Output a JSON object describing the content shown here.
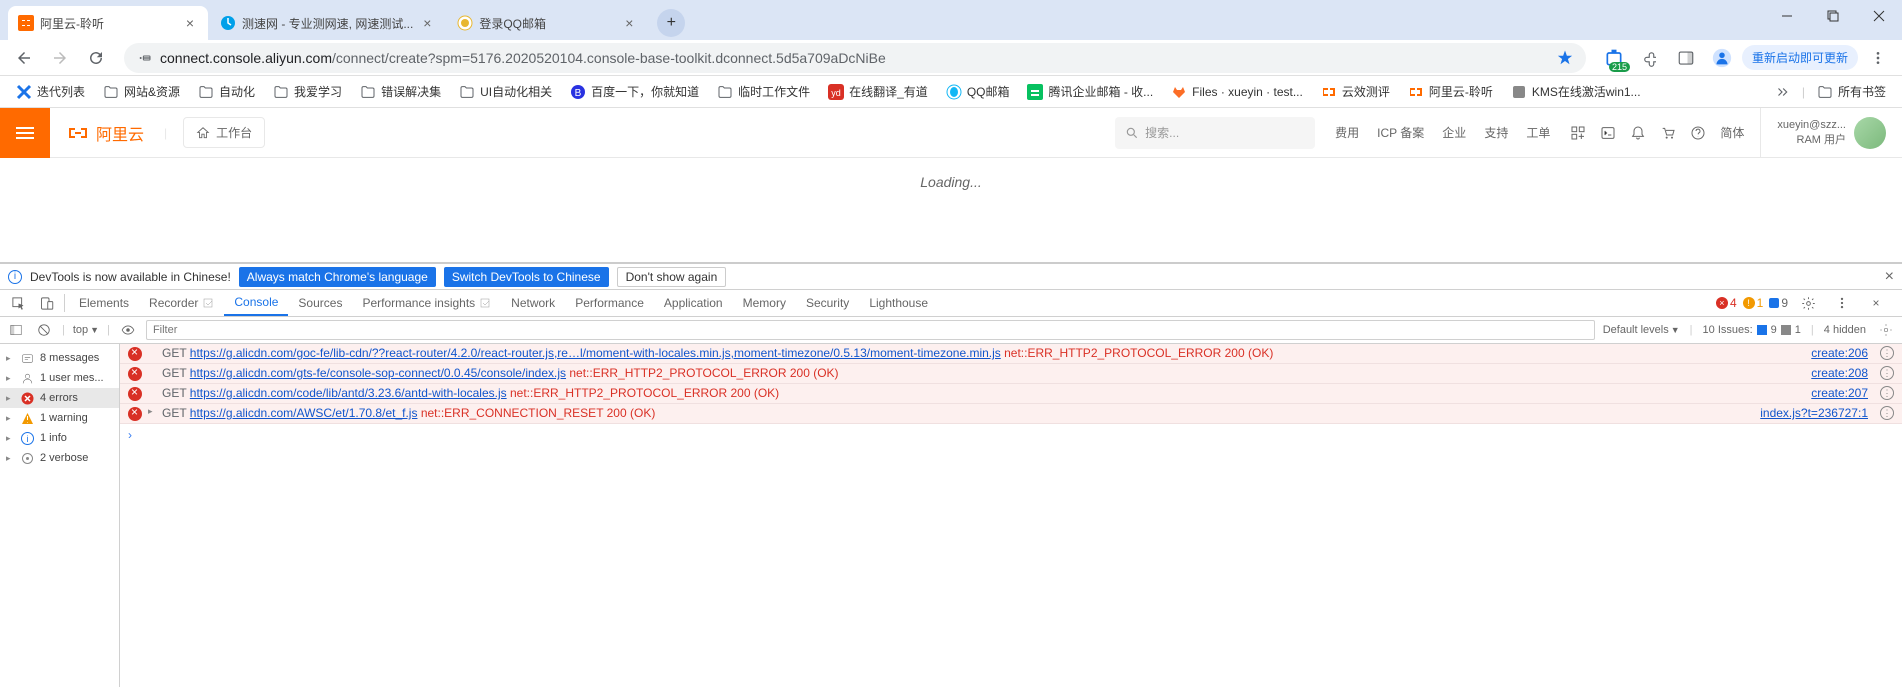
{
  "tabs": [
    {
      "title": "阿里云-聆听",
      "active": true,
      "favicon": "aliyun"
    },
    {
      "title": "测速网 - 专业测网速, 网速测试...",
      "active": false,
      "favicon": "speed"
    },
    {
      "title": "登录QQ邮箱",
      "active": false,
      "favicon": "qq"
    }
  ],
  "url": {
    "domain": "connect.console.aliyun.com",
    "path": "/connect/create?spm=5176.2020520104.console-base-toolkit.dconnect.5d5a709aDcNiBe"
  },
  "update_label": "重新启动即可更新",
  "bookmarks": [
    {
      "label": "迭代列表",
      "icon": "x-blue"
    },
    {
      "label": "网站&资源",
      "icon": "folder"
    },
    {
      "label": "自动化",
      "icon": "folder"
    },
    {
      "label": "我爱学习",
      "icon": "folder"
    },
    {
      "label": "错误解决集",
      "icon": "folder"
    },
    {
      "label": "UI自动化相关",
      "icon": "folder"
    },
    {
      "label": "百度一下，你就知道",
      "icon": "baidu"
    },
    {
      "label": "临时工作文件",
      "icon": "folder"
    },
    {
      "label": "在线翻译_有道",
      "icon": "youdao"
    },
    {
      "label": "QQ邮箱",
      "icon": "qq"
    },
    {
      "label": "腾讯企业邮箱 - 收...",
      "icon": "tencent"
    },
    {
      "label": "Files · xueyin · test...",
      "icon": "gitlab"
    },
    {
      "label": "云效测评",
      "icon": "aliyun"
    },
    {
      "label": "阿里云-聆听",
      "icon": "aliyun"
    },
    {
      "label": "KMS在线激活win1...",
      "icon": "generic"
    }
  ],
  "bookmarks_right": "所有书签",
  "ext_badge": "215",
  "aliyun": {
    "brand": "阿里云",
    "workspace": "工作台",
    "search_placeholder": "搜索...",
    "links": [
      "费用",
      "ICP 备案",
      "企业",
      "支持",
      "工单"
    ],
    "lang": "简体",
    "user_line1": "xueyin@szz...",
    "user_line2": "RAM 用户",
    "loading": "Loading..."
  },
  "devtools": {
    "banner": {
      "msg": "DevTools is now available in Chinese!",
      "btn1": "Always match Chrome's language",
      "btn2": "Switch DevTools to Chinese",
      "btn3": "Don't show again"
    },
    "tabs": [
      "Elements",
      "Recorder",
      "Console",
      "Sources",
      "Performance insights",
      "Network",
      "Performance",
      "Application",
      "Memory",
      "Security",
      "Lighthouse"
    ],
    "active_tab": "Console",
    "counts": {
      "errors": "4",
      "warnings": "1",
      "info": "9"
    },
    "filter": {
      "top": "top",
      "placeholder": "Filter",
      "levels": "Default levels",
      "issues_label": "10 Issues:",
      "issues_blue": "9",
      "issues_gray": "1",
      "hidden": "4 hidden"
    },
    "sidebar": [
      {
        "label": "8 messages",
        "icon": "msg"
      },
      {
        "label": "1 user mes...",
        "icon": "user"
      },
      {
        "label": "4 errors",
        "icon": "error",
        "selected": true
      },
      {
        "label": "1 warning",
        "icon": "warn"
      },
      {
        "label": "1 info",
        "icon": "info"
      },
      {
        "label": "2 verbose",
        "icon": "verbose"
      }
    ],
    "logs": [
      {
        "method": "GET",
        "url": "https://g.alicdn.com/goc-fe/lib-cdn/??react-router/4.2.0/react-router.js,re…l/moment-with-locales.min.js,moment-timezone/0.5.13/moment-timezone.min.js",
        "status": "net::ERR_HTTP2_PROTOCOL_ERROR 200 (OK)",
        "link": "create:206"
      },
      {
        "method": "GET",
        "url": "https://g.alicdn.com/gts-fe/console-sop-connect/0.0.45/console/index.js",
        "status": "net::ERR_HTTP2_PROTOCOL_ERROR 200 (OK)",
        "link": "create:208"
      },
      {
        "method": "GET",
        "url": "https://g.alicdn.com/code/lib/antd/3.23.6/antd-with-locales.js",
        "status": "net::ERR_HTTP2_PROTOCOL_ERROR 200 (OK)",
        "link": "create:207"
      },
      {
        "method": "GET",
        "url": "https://g.alicdn.com/AWSC/et/1.70.8/et_f.js",
        "status": "net::ERR_CONNECTION_RESET 200 (OK)",
        "link": "index.js?t=236727:1",
        "expand": true
      }
    ]
  }
}
